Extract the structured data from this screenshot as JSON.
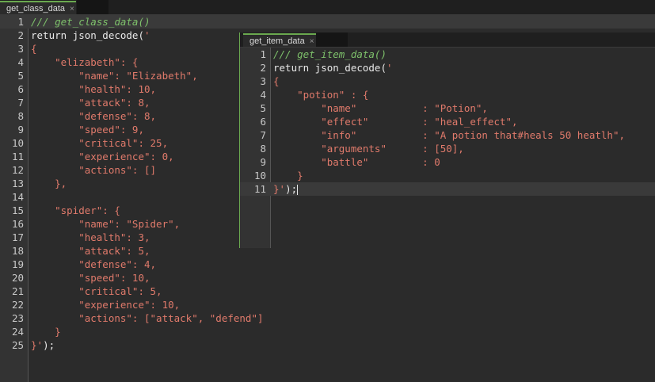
{
  "tabs": {
    "main": {
      "label": "get_class_data",
      "close": "×"
    },
    "item": {
      "label": "get_item_data",
      "close": "×"
    }
  },
  "main_editor": {
    "lines": [
      {
        "n": "1",
        "t": "/// get_class_data()",
        "kind": "comment"
      },
      {
        "n": "2",
        "t": "return json_decode('",
        "kind": "code"
      },
      {
        "n": "3",
        "t": "{",
        "kind": "str"
      },
      {
        "n": "4",
        "t": "    \"elizabeth\": {",
        "kind": "str"
      },
      {
        "n": "5",
        "t": "        \"name\": \"Elizabeth\",",
        "kind": "str"
      },
      {
        "n": "6",
        "t": "        \"health\": 10,",
        "kind": "str"
      },
      {
        "n": "7",
        "t": "        \"attack\": 8,",
        "kind": "str"
      },
      {
        "n": "8",
        "t": "        \"defense\": 8,",
        "kind": "str"
      },
      {
        "n": "9",
        "t": "        \"speed\": 9,",
        "kind": "str"
      },
      {
        "n": "10",
        "t": "        \"critical\": 25,",
        "kind": "str"
      },
      {
        "n": "11",
        "t": "        \"experience\": 0,",
        "kind": "str"
      },
      {
        "n": "12",
        "t": "        \"actions\": []",
        "kind": "str"
      },
      {
        "n": "13",
        "t": "    },",
        "kind": "str"
      },
      {
        "n": "14",
        "t": "",
        "kind": "str"
      },
      {
        "n": "15",
        "t": "    \"spider\": {",
        "kind": "str"
      },
      {
        "n": "16",
        "t": "        \"name\": \"Spider\",",
        "kind": "str"
      },
      {
        "n": "17",
        "t": "        \"health\": 3,",
        "kind": "str"
      },
      {
        "n": "18",
        "t": "        \"attack\": 5,",
        "kind": "str"
      },
      {
        "n": "19",
        "t": "        \"defense\": 4,",
        "kind": "str"
      },
      {
        "n": "20",
        "t": "        \"speed\": 10,",
        "kind": "str"
      },
      {
        "n": "21",
        "t": "        \"critical\": 5,",
        "kind": "str"
      },
      {
        "n": "22",
        "t": "        \"experience\": 10,",
        "kind": "str"
      },
      {
        "n": "23",
        "t": "        \"actions\": [\"attack\", \"defend\"]",
        "kind": "str"
      },
      {
        "n": "24",
        "t": "    }",
        "kind": "str"
      },
      {
        "n": "25",
        "t": "}');",
        "kind": "end"
      }
    ]
  },
  "item_editor": {
    "lines": [
      {
        "n": "1",
        "t": "/// get_item_data()",
        "kind": "comment"
      },
      {
        "n": "2",
        "t": "return json_decode('",
        "kind": "code"
      },
      {
        "n": "3",
        "t": "{",
        "kind": "str"
      },
      {
        "n": "4",
        "t": "    \"potion\" : {",
        "kind": "str"
      },
      {
        "n": "5",
        "t": "        \"name\"           : \"Potion\",",
        "kind": "str"
      },
      {
        "n": "6",
        "t": "        \"effect\"         : \"heal_effect\",",
        "kind": "str"
      },
      {
        "n": "7",
        "t": "        \"info\"           : \"A potion that#heals 50 heatlh\",",
        "kind": "str"
      },
      {
        "n": "8",
        "t": "        \"arguments\"      : [50],",
        "kind": "str"
      },
      {
        "n": "9",
        "t": "        \"battle\"         : 0",
        "kind": "str"
      },
      {
        "n": "10",
        "t": "    }",
        "kind": "str"
      },
      {
        "n": "11",
        "t": "}');",
        "kind": "end"
      }
    ]
  }
}
